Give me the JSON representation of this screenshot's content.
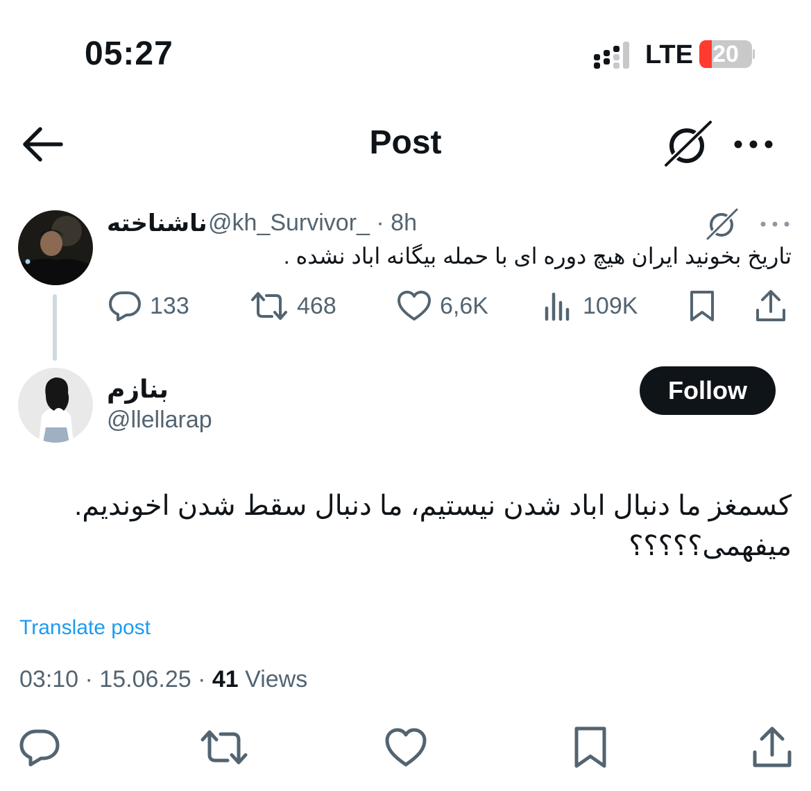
{
  "status_bar": {
    "time": "05:27",
    "network": "LTE",
    "battery": "20"
  },
  "header": {
    "title": "Post"
  },
  "parent_post": {
    "display_name": "ناشناخته",
    "handle": "@kh_Survivor_",
    "separator": "·",
    "age": "8h",
    "text": "تاریخ بخونید ایران هیچ دوره ای با حمله بیگانه اباد نشده .",
    "replies": "133",
    "reposts": "468",
    "likes": "6,6K",
    "views": "109K"
  },
  "reply_post": {
    "display_name": "بنازم",
    "handle": "@llellarap",
    "follow_label": "Follow",
    "text_line1": "کسمغز ما دنبال اباد شدن نیستیم، ما دنبال سقط شدن اخوندیم.",
    "text_line2": "میفهمی؟؟؟؟؟",
    "translate_label": "Translate post",
    "timestamp": "03:10 · 15.06.25 ·",
    "views_count": "41",
    "views_label": "Views"
  },
  "colors": {
    "text_primary": "#0f1419",
    "text_secondary": "#536471",
    "link": "#1d9bf0",
    "battery_low": "#ff3b30"
  }
}
